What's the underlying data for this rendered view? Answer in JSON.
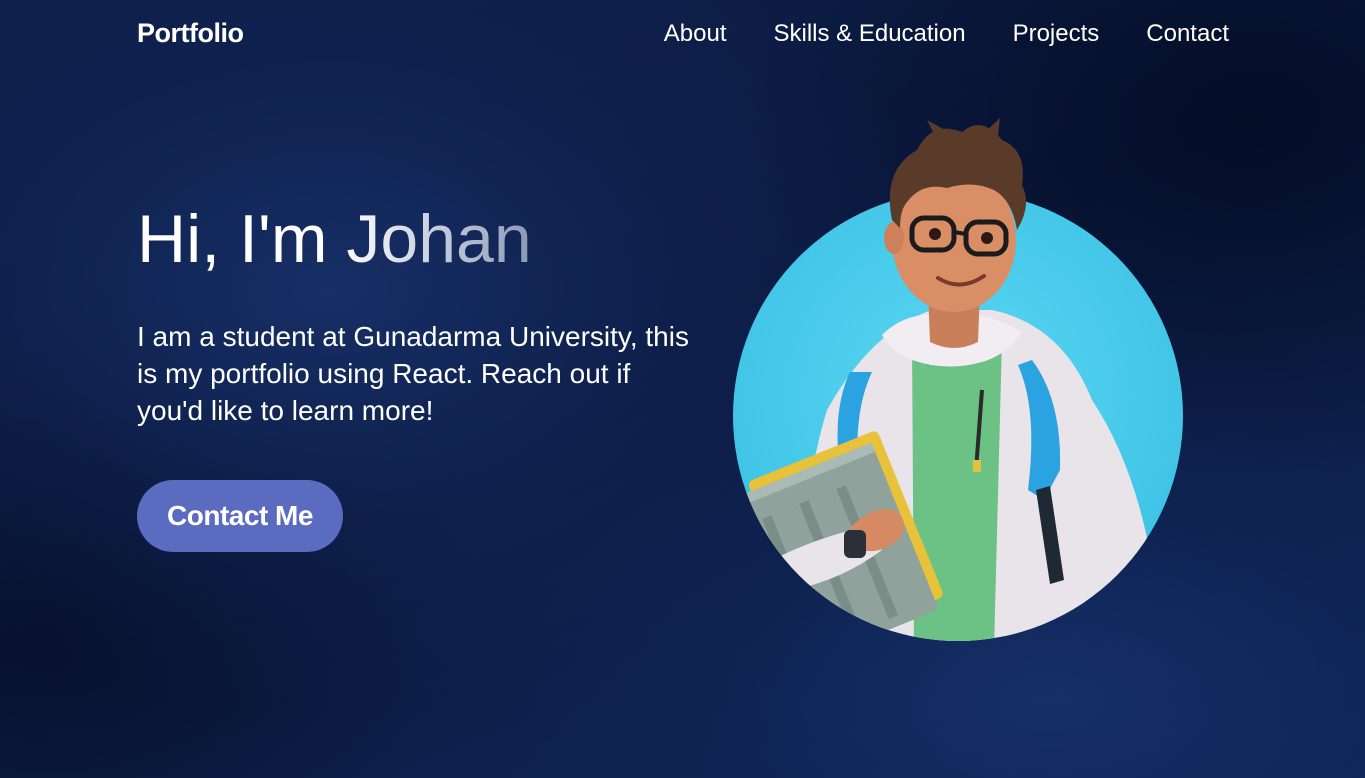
{
  "brand": "Portfolio",
  "nav": {
    "items": [
      {
        "label": "About"
      },
      {
        "label": "Skills & Education"
      },
      {
        "label": "Projects"
      },
      {
        "label": "Contact"
      }
    ]
  },
  "hero": {
    "title": "Hi, I'm Johan",
    "description": "I am a student at Gunadarma University, this is my portfolio using React. Reach out if you'd like to learn more!",
    "cta_label": "Contact Me"
  },
  "colors": {
    "background": "#0c1a3e",
    "accent_button": "#5b6bbf",
    "avatar_circle": "#4fd2ef"
  },
  "icons": {
    "avatar": "student-avatar-illustration"
  }
}
